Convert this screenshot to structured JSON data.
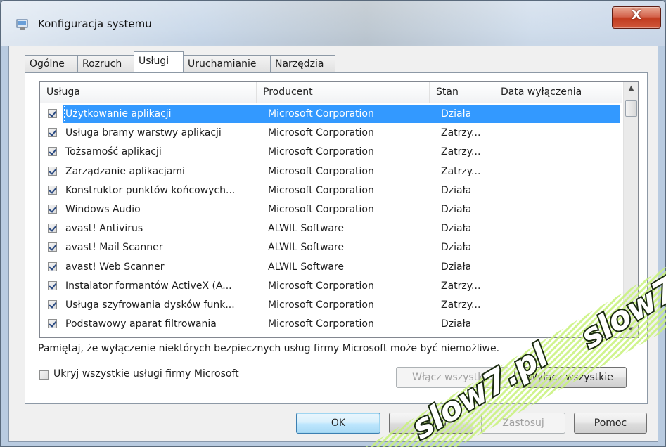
{
  "window": {
    "title": "Konfiguracja systemu",
    "close_label": "X"
  },
  "tabs": [
    {
      "label": "Ogólne",
      "active": false
    },
    {
      "label": "Rozruch",
      "active": false
    },
    {
      "label": "Usługi",
      "active": true
    },
    {
      "label": "Uruchamianie",
      "active": false
    },
    {
      "label": "Narzędzia",
      "active": false
    }
  ],
  "services": {
    "columns": [
      "Usługa",
      "Producent",
      "Stan",
      "Data wyłączenia"
    ],
    "rows": [
      {
        "name": "Użytkowanie aplikacji",
        "vendor": "Microsoft Corporation",
        "state": "Działa",
        "date": "",
        "checked": true,
        "selected": true
      },
      {
        "name": "Usługa bramy warstwy aplikacji",
        "vendor": "Microsoft Corporation",
        "state": "Zatrzy...",
        "date": "",
        "checked": true
      },
      {
        "name": "Tożsamość aplikacji",
        "vendor": "Microsoft Corporation",
        "state": "Zatrzy...",
        "date": "",
        "checked": true
      },
      {
        "name": "Zarządzanie aplikacjami",
        "vendor": "Microsoft Corporation",
        "state": "Zatrzy...",
        "date": "",
        "checked": true
      },
      {
        "name": "Konstruktor punktów końcowych...",
        "vendor": "Microsoft Corporation",
        "state": "Działa",
        "date": "",
        "checked": true
      },
      {
        "name": "Windows Audio",
        "vendor": "Microsoft Corporation",
        "state": "Działa",
        "date": "",
        "checked": true
      },
      {
        "name": "avast! Antivirus",
        "vendor": "ALWIL Software",
        "state": "Działa",
        "date": "",
        "checked": true
      },
      {
        "name": "avast! Mail Scanner",
        "vendor": "ALWIL Software",
        "state": "Działa",
        "date": "",
        "checked": true
      },
      {
        "name": "avast! Web Scanner",
        "vendor": "ALWIL Software",
        "state": "Działa",
        "date": "",
        "checked": true
      },
      {
        "name": "Instalator formantów ActiveX (A...",
        "vendor": "Microsoft Corporation",
        "state": "Zatrzy...",
        "date": "",
        "checked": true
      },
      {
        "name": "Usługa szyfrowania dysków funk...",
        "vendor": "Microsoft Corporation",
        "state": "Zatrzy...",
        "date": "",
        "checked": true
      },
      {
        "name": "Podstawowy aparat filtrowania",
        "vendor": "Microsoft Corporation",
        "state": "Działa",
        "date": "",
        "checked": true
      }
    ]
  },
  "notice": "Pamiętaj, że wyłączenie niektórych bezpiecznych usług firmy Microsoft może być niemożliwe.",
  "hide_ms": {
    "label": "Ukryj wszystkie usługi firmy Microsoft",
    "checked": false
  },
  "buttons": {
    "enable_all": "Włącz wszystkie",
    "disable_all": "Wyłącz wszystkie",
    "ok": "OK",
    "cancel": "Anuluj",
    "apply": "Zastosuj",
    "help": "Pomoc"
  },
  "watermark": {
    "text": "slow7.pl",
    "band_color": "#c8f27a",
    "text_color": "#ffffff",
    "outline_color": "#1a2a10"
  },
  "colors": {
    "selection": "#3399ff",
    "close_button": "#c23c20"
  }
}
